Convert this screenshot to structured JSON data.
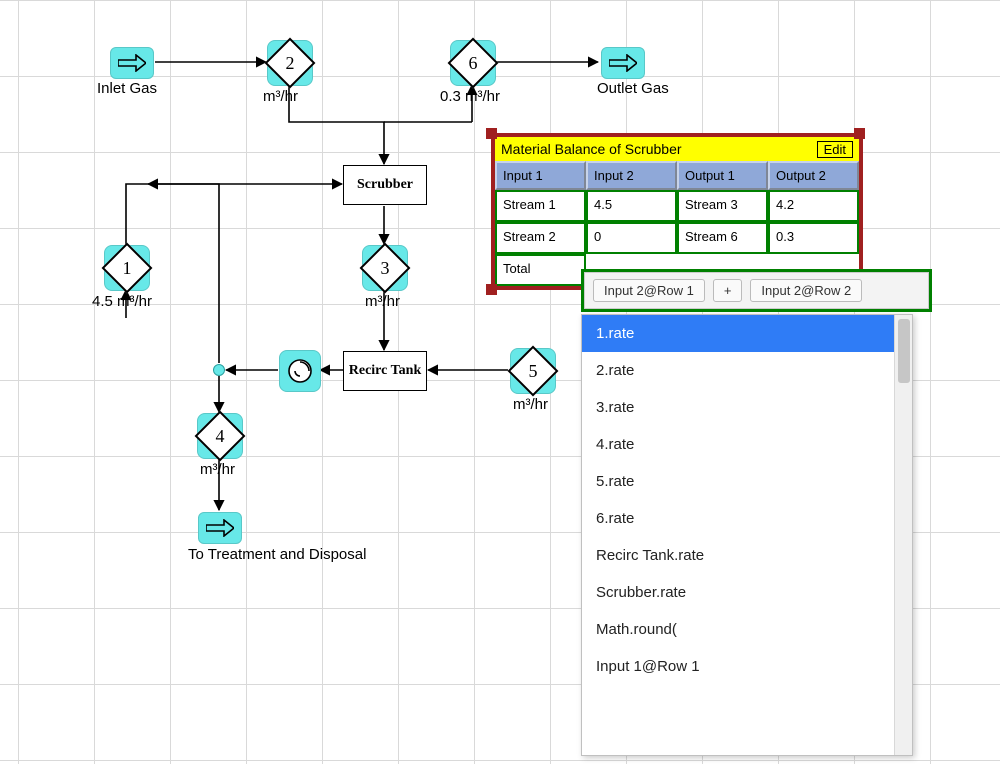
{
  "nodes": {
    "inlet_gas_label": "Inlet Gas",
    "outlet_gas_label": "Outlet Gas",
    "to_treatment_label": "To Treatment and Disposal",
    "scrubber_label": "Scrubber",
    "recirc_label": "Recirc Tank",
    "d1": {
      "num": "1",
      "rate": "4.5 m³/hr"
    },
    "d2": {
      "num": "2",
      "rate": "m³/hr"
    },
    "d3": {
      "num": "3",
      "rate": "m³/hr"
    },
    "d4": {
      "num": "4",
      "rate": "m³/hr"
    },
    "d5": {
      "num": "5",
      "rate": "m³/hr"
    },
    "d6": {
      "num": "6",
      "rate": "0.3 m³/hr"
    }
  },
  "panel": {
    "title": "Material Balance of Scrubber",
    "edit": "Edit",
    "headers": [
      "Input 1",
      "Input 2",
      "Output 1",
      "Output 2"
    ],
    "rows": [
      [
        "Stream 1",
        "4.5",
        "Stream 3",
        "4.2"
      ],
      [
        "Stream 2",
        "0",
        "Stream 6",
        "0.3"
      ],
      [
        "Total",
        "",
        "",
        ""
      ]
    ]
  },
  "formula": {
    "chips": [
      "Input 2@Row 1",
      "+",
      "Input 2@Row 2"
    ]
  },
  "dropdown": {
    "selected": 0,
    "options": [
      "1.rate",
      "2.rate",
      "3.rate",
      "4.rate",
      "5.rate",
      "6.rate",
      "Recirc Tank.rate",
      "Scrubber.rate",
      "Math.round(",
      "Input 1@Row 1"
    ]
  },
  "chart_data": {
    "type": "table",
    "title": "Material Balance of Scrubber",
    "columns": [
      "Input 1",
      "Input 2",
      "Output 1",
      "Output 2"
    ],
    "rows": [
      {
        "Input 1": "Stream 1",
        "Input 2": 4.5,
        "Output 1": "Stream 3",
        "Output 2": 4.2
      },
      {
        "Input 1": "Stream 2",
        "Input 2": 0,
        "Output 1": "Stream 6",
        "Output 2": 0.3
      },
      {
        "Input 1": "Total",
        "Input 2": null,
        "Output 1": null,
        "Output 2": null
      }
    ],
    "stream_rates_m3_per_hr": {
      "1": 4.5,
      "2": null,
      "3": null,
      "4": null,
      "5": null,
      "6": 0.3
    }
  }
}
